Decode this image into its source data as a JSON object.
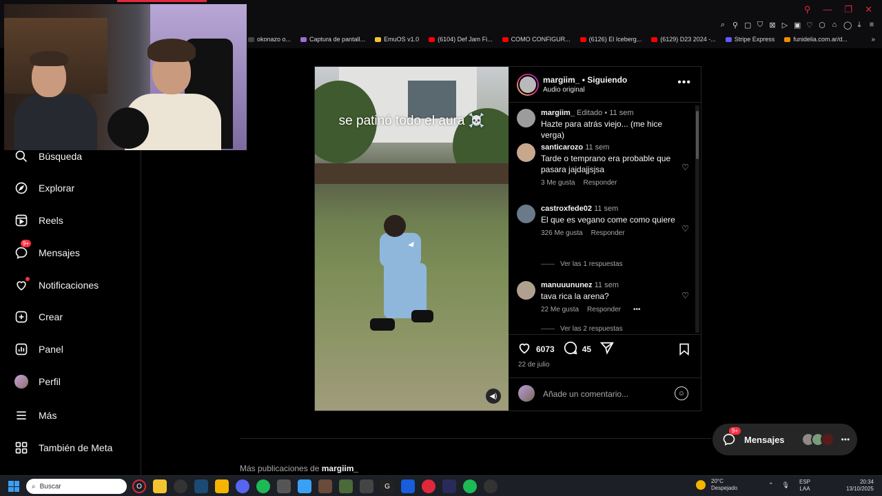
{
  "browser": {
    "window_controls": [
      "⚲",
      "—",
      "❐",
      "✕"
    ],
    "bookmarks": [
      {
        "label": "okonazo o...",
        "color": "#444444"
      },
      {
        "label": "Captura de pantall...",
        "color": "#a06cd5"
      },
      {
        "label": "EmuOS v1.0",
        "color": "#f4c430"
      },
      {
        "label": "(6104) Def Jam Fi...",
        "color": "#ff0000"
      },
      {
        "label": "COMO CONFIGUR...",
        "color": "#ff0000"
      },
      {
        "label": "(6126) El Iceberg...",
        "color": "#ff0000"
      },
      {
        "label": "(6129) D23 2024 -...",
        "color": "#ff0000"
      },
      {
        "label": "Stripe Express",
        "color": "#635bff"
      },
      {
        "label": "funidelia.com.ar/d...",
        "color": "#f28c00"
      }
    ],
    "more_bookmarks": "»"
  },
  "sidebar": {
    "items": [
      {
        "label": "Búsqueda",
        "icon": "search-icon"
      },
      {
        "label": "Explorar",
        "icon": "compass-icon"
      },
      {
        "label": "Reels",
        "icon": "reels-icon"
      },
      {
        "label": "Mensajes",
        "icon": "messenger-icon",
        "badge": "9+"
      },
      {
        "label": "Notificaciones",
        "icon": "heart-icon"
      },
      {
        "label": "Crear",
        "icon": "plus-square-icon"
      },
      {
        "label": "Panel",
        "icon": "chart-icon"
      },
      {
        "label": "Perfil",
        "icon": "avatar"
      },
      {
        "label": "Más",
        "icon": "menu-icon"
      },
      {
        "label": "También de Meta",
        "icon": "meta-icon"
      }
    ]
  },
  "post": {
    "overlay_text": "se patinó todo el aura ☠️",
    "author": "margiim_",
    "follow_status": "• Siguiendo",
    "audio": "Audio original",
    "caption": {
      "user": "margiim_",
      "meta": "Editado • 11 sem",
      "text": "Hazte para atrás viejo... (me hice verga)"
    },
    "comments": [
      {
        "user": "santicarozo",
        "time": "11 sem",
        "text": "Tarde o temprano era probable que pasara jajdajjsjsa",
        "likes": "3 Me gusta",
        "reply": "Responder"
      },
      {
        "user": "castroxfede02",
        "time": "11 sem",
        "text": "El que es vegano come como quiere",
        "likes": "326 Me gusta",
        "reply": "Responder",
        "replies": "Ver las 1 respuestas"
      },
      {
        "user": "manuuununez",
        "time": "11 sem",
        "text": "tava rica la arena?",
        "likes": "22 Me gusta",
        "reply": "Responder",
        "replies": "Ver las 2 respuestas"
      }
    ],
    "likes_count": "6073",
    "comments_count": "45",
    "date": "22 de julio",
    "comment_placeholder": "Añade un comentario..."
  },
  "more_posts": {
    "prefix": "Más publicaciones de",
    "user": "margiim_"
  },
  "messages_pill": {
    "label": "Mensajes",
    "badge": "9+"
  },
  "taskbar": {
    "search_placeholder": "Buscar",
    "weather_temp": "20°C",
    "weather_desc": "Despejado",
    "lang_top": "ESP",
    "lang_bottom": "LAA",
    "time": "20:34",
    "date": "13/10/2025"
  },
  "colors": {
    "accent": "#ff3040",
    "background": "#000000",
    "muted": "#a8a8a8"
  }
}
